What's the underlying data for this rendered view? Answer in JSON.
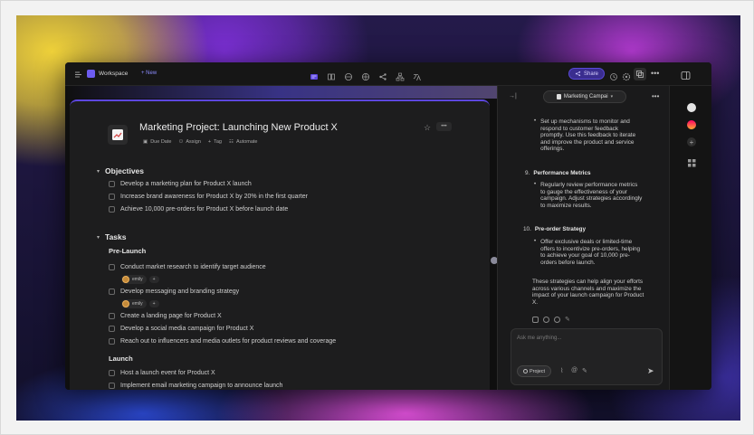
{
  "topbar": {
    "workspace_label": "Workspace",
    "new_label": "+ New",
    "share_label": "Share",
    "center_icons": [
      "page-icon",
      "book-icon",
      "globe-icon",
      "grid-globe-icon",
      "share-nodes-icon",
      "sitemap-icon",
      "translate-icon"
    ],
    "right_icons": [
      "history-icon",
      "settings-icon",
      "layers-icon",
      "more-icon",
      "sidebar-toggle-icon"
    ]
  },
  "document": {
    "title": "Marketing Project: Launching New Product X",
    "toolbar": [
      "Due Date",
      "Assign",
      "Tag",
      "Automate"
    ],
    "sections": {
      "objectives": {
        "heading": "Objectives",
        "items": [
          "Develop a marketing plan for Product X launch",
          "Increase brand awareness for Product X by 20% in the first quarter",
          "Achieve 10,000 pre-orders for Product X before launch date"
        ]
      },
      "tasks": {
        "heading": "Tasks",
        "prelaunch_heading": "Pre-Launch",
        "prelaunch_items": [
          "Conduct market research to identify target audience",
          "Develop messaging and branding strategy",
          "Create a landing page for Product X",
          "Develop a social media campaign for Product X",
          "Reach out to influencers and media outlets for product reviews and coverage"
        ],
        "assignee": "emily",
        "launch_heading": "Launch",
        "launch_items": [
          "Host a launch event for Product X",
          "Implement email marketing campaign to announce launch"
        ]
      }
    }
  },
  "chat": {
    "title": "Marketing Campai",
    "bullet_intro": "Set up mechanisms to monitor and respond to customer feedback promptly. Use this feedback to iterate and improve the product and service offerings.",
    "item9_title": "Performance Metrics",
    "item9_bullet": "Regularly review performance metrics to gauge the effectiveness of your campaign. Adjust strategies accordingly to maximize results.",
    "item10_title": "Pre-order Strategy",
    "item10_bullet": "Offer exclusive deals or limited-time offers to incentivize pre-orders, helping to achieve your goal of 10,000 pre-orders before launch.",
    "summary": "These strategies can help align your efforts across various channels and maximize the impact of your launch campaign for Product X.",
    "input_placeholder": "Ask me anything...",
    "project_label": "Project"
  },
  "colors": {
    "accent": "#5d47e0",
    "share_bg": "#3a2d8f"
  }
}
